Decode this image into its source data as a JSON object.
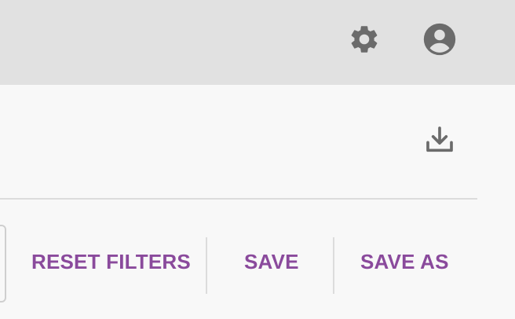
{
  "header": {
    "settings_icon": "gear-icon",
    "account_icon": "account-circle-icon"
  },
  "toolbar": {
    "download_icon": "download-icon"
  },
  "actions": {
    "reset_filters_label": "RESET FILTERS",
    "save_label": "SAVE",
    "save_as_label": "SAVE AS"
  },
  "colors": {
    "header_bg": "#e1e1e1",
    "content_bg": "#f8f8f8",
    "icon": "#6b6b6b",
    "accent": "#8a4a9c",
    "divider": "#dcdcdc"
  }
}
